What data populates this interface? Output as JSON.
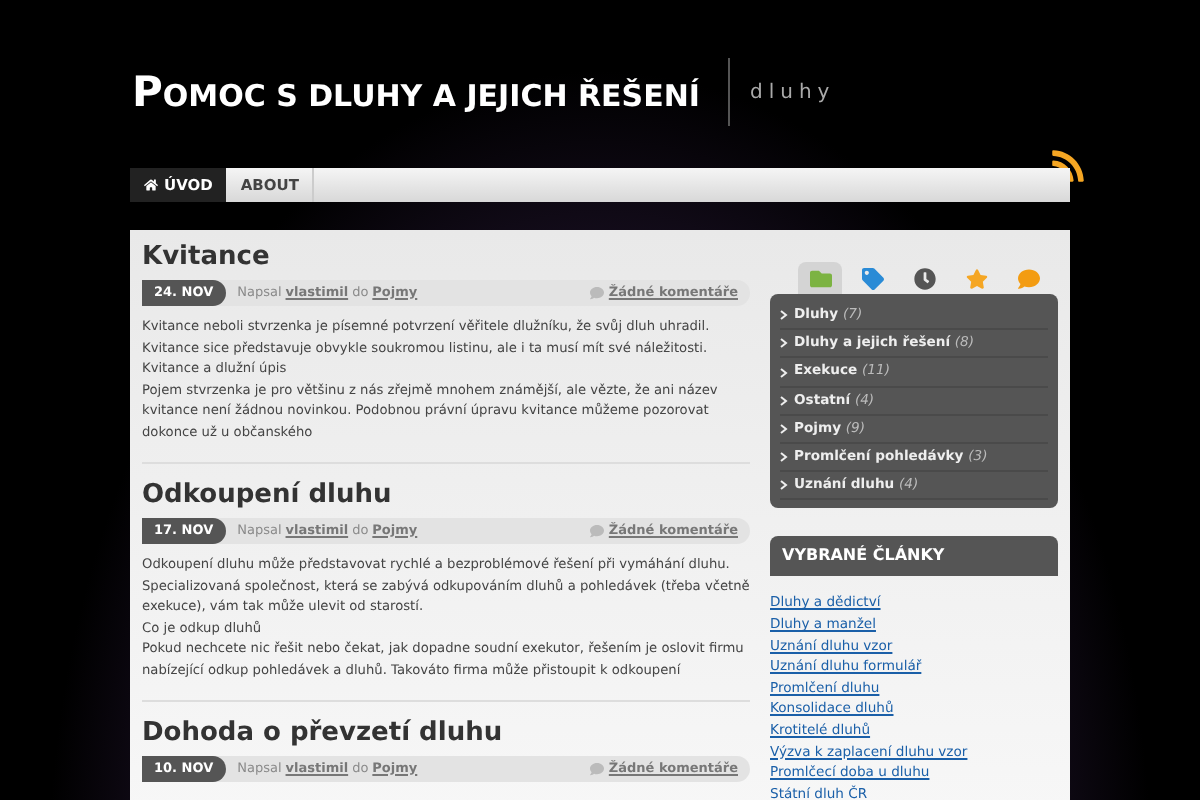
{
  "site": {
    "title": "POMOC S DLUHY A JEJICH ŘEŠENÍ",
    "tagline": "dluhy"
  },
  "nav": [
    {
      "label": "ÚVOD",
      "selected": true,
      "kind": "home"
    },
    {
      "label": "ABOUT",
      "selected": false,
      "kind": "page"
    }
  ],
  "posts": [
    {
      "title": "Kvitance",
      "date": "24. NOV",
      "by": "Napsal",
      "author": "vlastimil",
      "in": "do",
      "category": "Pojmy",
      "comments": "Žádné komentáře",
      "paragraphs": [
        "Kvitance neboli stvrzenka je písemné potvrzení věřitele dlužníku, že svůj dluh uhradil. Kvitance sice představuje obvykle soukromou listinu, ale i ta musí mít své náležitosti.",
        "Kvitance a dlužní úpis",
        "Pojem stvrzenka je pro většinu z nás zřejmě mnohem známější, ale vězte, že ani název kvitance není žádnou novinkou. Podobnou právní úpravu kvitance můžeme pozorovat dokonce už u občanského"
      ]
    },
    {
      "title": "Odkoupení dluhu",
      "date": "17. NOV",
      "by": "Napsal",
      "author": "vlastimil",
      "in": "do",
      "category": "Pojmy",
      "comments": "Žádné komentáře",
      "paragraphs": [
        "Odkoupení dluhu může představovat rychlé a bezproblémové řešení při vymáhání dluhu. Specializovaná společnost, která se zabývá odkupováním dluhů a pohledávek (třeba včetně exekuce), vám tak může ulevit od starostí.",
        "Co je odkup dluhů",
        "Pokud nechcete nic řešit nebo čekat, jak dopadne soudní exekutor, řešením je oslovit firmu nabízející odkup pohledávek a dluhů. Takováto firma může přistoupit k odkoupení"
      ]
    },
    {
      "title": "Dohoda o převzetí dluhu",
      "date": "10. NOV",
      "by": "Napsal",
      "author": "vlastimil",
      "in": "do",
      "category": "Pojmy",
      "comments": "Žádné komentáře"
    }
  ],
  "sidebar_tabs": [
    {
      "kind": "folder",
      "selected": true
    },
    {
      "kind": "tag",
      "selected": false
    },
    {
      "kind": "clock",
      "selected": false
    },
    {
      "kind": "star",
      "selected": false
    },
    {
      "kind": "comment",
      "selected": false
    }
  ],
  "categories": [
    {
      "name": "Dluhy",
      "count": "(7)"
    },
    {
      "name": "Dluhy a jejich řešení",
      "count": "(8)"
    },
    {
      "name": "Exekuce",
      "count": "(11)"
    },
    {
      "name": "Ostatní",
      "count": "(4)"
    },
    {
      "name": "Pojmy",
      "count": "(9)"
    },
    {
      "name": "Promlčení pohledávky",
      "count": "(3)"
    },
    {
      "name": "Uznání dluhu",
      "count": "(4)"
    }
  ],
  "featured": {
    "title": "VYBRANÉ ČLÁNKY",
    "links": [
      "Dluhy a dědictví",
      "Dluhy a manžel",
      "Uznání dluhu vzor",
      "Uznání dluhu formulář",
      "Promlčení dluhu",
      "Konsolidace dluhů",
      "Krotitelé dluhů",
      "Výzva k zaplacení dluhu vzor",
      "Promlčecí doba u dluhu",
      "Státní dluh ČR"
    ]
  }
}
